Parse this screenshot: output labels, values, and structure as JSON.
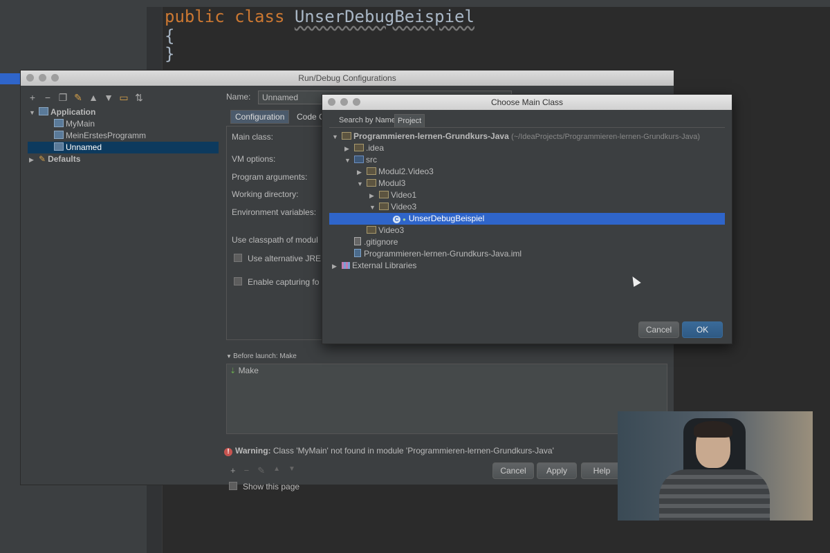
{
  "editor": {
    "line1_kw1": "public",
    "line1_kw2": "class",
    "line1_class": "UnserDebugBeispiel",
    "line2": "{",
    "line3": "}"
  },
  "run_debug": {
    "title": "Run/Debug Configurations",
    "toolbar_icons": [
      "add-icon",
      "remove-icon",
      "copy-icon",
      "wrench-icon",
      "move-up-icon",
      "move-down-icon",
      "folder-icon",
      "sort-icon"
    ],
    "tree": {
      "application": "Application",
      "items": [
        "MyMain",
        "MeinErstesProgramm",
        "Unnamed"
      ],
      "defaults": "Defaults"
    },
    "name_label": "Name:",
    "name_value": "Unnamed",
    "tabs": [
      "Configuration",
      "Code C"
    ],
    "fields": {
      "main_class": "Main class:",
      "vm_options": "VM options:",
      "program_arguments": "Program arguments:",
      "working_directory": "Working directory:",
      "environment_variables": "Environment variables:",
      "use_classpath": "Use classpath of modul",
      "alt_jre": "Use alternative JRE:",
      "enable_capturing": "Enable capturing fo"
    },
    "before_launch": "Before launch: Make",
    "make_item": "Make",
    "show_this_page": "Show this page",
    "warning_label": "Warning:",
    "warning_text": "Class 'MyMain' not found in module 'Programmieren-lernen-Grundkurs-Java'",
    "buttons": {
      "cancel": "Cancel",
      "apply": "Apply",
      "help": "Help"
    }
  },
  "choose_main": {
    "title": "Choose Main Class",
    "tabs": [
      "Search by Name",
      "Project"
    ],
    "tree": {
      "project": "Programmieren-lernen-Grundkurs-Java",
      "project_path": "(~/IdeaProjects/Programmieren-lernen-Grundkurs-Java)",
      "idea": ".idea",
      "src": "src",
      "modul2": "Modul2.Video3",
      "modul3": "Modul3",
      "video1": "Video1",
      "video3": "Video3",
      "selected_class": "UnserDebugBeispiel",
      "video3_b": "Video3",
      "gitignore": ".gitignore",
      "iml": "Programmieren-lernen-Grundkurs-Java.iml",
      "external": "External Libraries"
    },
    "buttons": {
      "cancel": "Cancel",
      "ok": "OK"
    }
  },
  "colors": {
    "keyword": "#cc7832",
    "selection": "#2f65ca",
    "dialog_bg": "#3c3f41"
  }
}
